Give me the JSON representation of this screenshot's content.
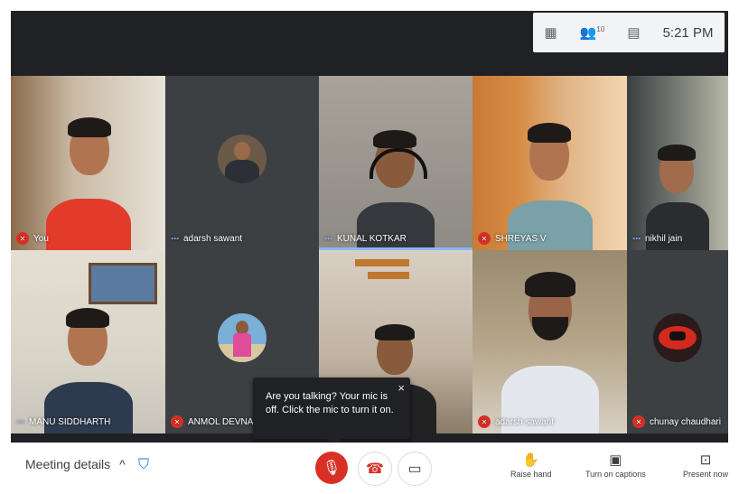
{
  "status_bar": {
    "icons": [
      "info-icon",
      "people-icon",
      "chat-icon"
    ],
    "participant_count": "10",
    "time": "5:21 PM"
  },
  "participants": [
    {
      "name": "You",
      "mic": "off",
      "type": "video"
    },
    {
      "name": "adarsh sawant",
      "mic": "dots",
      "type": "avatar"
    },
    {
      "name": "KUNAL KOTKAR",
      "mic": "dots",
      "type": "video",
      "speaking": true
    },
    {
      "name": "SHREYAS V",
      "mic": "off",
      "type": "video"
    },
    {
      "name": "nikhil jain",
      "mic": "dots",
      "type": "video"
    },
    {
      "name": "MANU SIDDHARTH",
      "mic": "dots",
      "type": "video"
    },
    {
      "name": "ANMOL DEVNANI",
      "mic": "off",
      "type": "avatar"
    },
    {
      "name": "",
      "mic": "none",
      "type": "video"
    },
    {
      "name": "adarsh sawant",
      "mic": "off",
      "type": "video"
    },
    {
      "name": "chunay chaudhari",
      "mic": "off",
      "type": "avatar"
    }
  ],
  "toast": {
    "message": "Are you talking? Your mic is off. Click the mic to turn it on.",
    "close": "×"
  },
  "bottom_bar": {
    "meeting_details_label": "Meeting details",
    "chevron": "^",
    "raise_hand_label": "Raise hand",
    "captions_label": "Turn on captions",
    "present_label": "Present now"
  },
  "colors": {
    "stage_bg": "#202124",
    "mic_off_red": "#d93025",
    "speaking_blue": "#8ab4f8",
    "security_blue": "#1a73e8"
  }
}
